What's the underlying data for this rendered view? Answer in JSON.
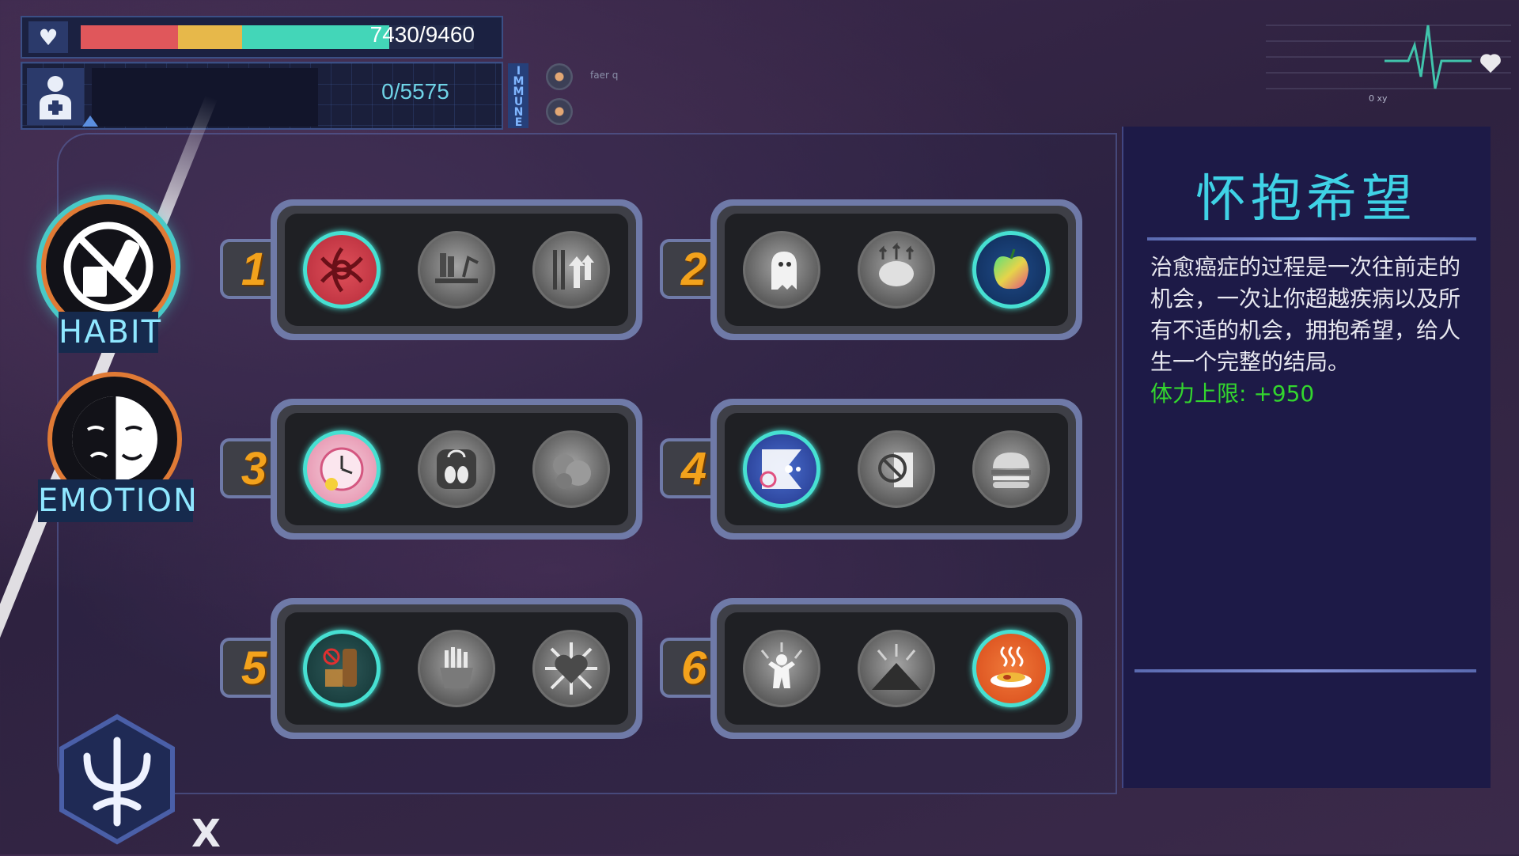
{
  "hud": {
    "health": {
      "text": "7430/9460",
      "fill_fraction": 0.785,
      "segments": [
        "#e0575b",
        "#e7b84a",
        "#43d6b8"
      ]
    },
    "immune": {
      "text": "0/5575",
      "label": "IMMUNE",
      "fill_fraction": 0.0
    },
    "status_text": "faer q",
    "ecg_label": "0 xy"
  },
  "categories": [
    {
      "label": "HABIT",
      "icon": "no-drinking-smoking-icon",
      "selected": true
    },
    {
      "label": "EMOTION",
      "icon": "sad-happy-face-icon",
      "selected": false
    }
  ],
  "tiers": [
    {
      "number": "1",
      "skills": [
        {
          "icon": "stress-tangle-icon",
          "unlocked": true
        },
        {
          "icon": "desk-lamp-reading-icon",
          "unlocked": false
        },
        {
          "icon": "upward-arrows-icon",
          "unlocked": false
        }
      ]
    },
    {
      "number": "2",
      "skills": [
        {
          "icon": "running-ghost-icon",
          "unlocked": false
        },
        {
          "icon": "brain-growth-icon",
          "unlocked": false
        },
        {
          "icon": "rainbow-apple-icon",
          "unlocked": true
        }
      ]
    },
    {
      "number": "3",
      "skills": [
        {
          "icon": "sleep-clock-icon",
          "unlocked": true
        },
        {
          "icon": "scale-feet-icon",
          "unlocked": false
        },
        {
          "icon": "tomatoes-icon",
          "unlocked": false
        }
      ]
    },
    {
      "number": "4",
      "skills": [
        {
          "icon": "pacman-bubbles-icon",
          "unlocked": true
        },
        {
          "icon": "no-smoking-pack-icon",
          "unlocked": false
        },
        {
          "icon": "burger-icon",
          "unlocked": false
        }
      ]
    },
    {
      "number": "5",
      "skills": [
        {
          "icon": "no-alcohol-bottle-icon",
          "unlocked": true
        },
        {
          "icon": "fries-icon",
          "unlocked": false
        },
        {
          "icon": "heart-sunburst-icon",
          "unlocked": false
        }
      ]
    },
    {
      "number": "6",
      "skills": [
        {
          "icon": "person-glow-icon",
          "unlocked": false
        },
        {
          "icon": "mountain-icon",
          "unlocked": false
        },
        {
          "icon": "hot-meal-icon",
          "unlocked": true
        }
      ]
    }
  ],
  "info_panel": {
    "title": "怀抱希望",
    "description": "治愈癌症的过程是一次往前走的机会，一次让你超越疾病以及所有不适的机会，拥抱希望，给人生一个完整的结局。",
    "stat": "体力上限: +950"
  },
  "close_label": "X",
  "colors": {
    "accent_cyan": "#3fd2e6",
    "tier_number": "#f3a21c",
    "stat_green": "#33d62e",
    "orange_ring": "#e07a35"
  }
}
